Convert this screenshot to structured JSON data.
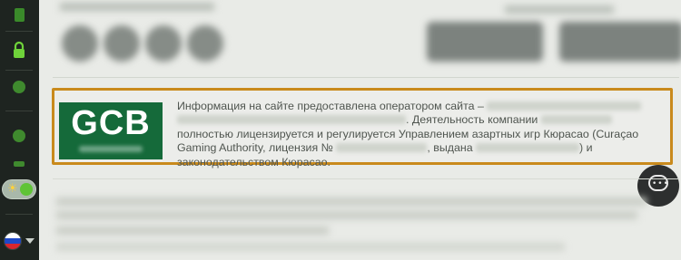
{
  "sidebar": {
    "icons": [
      {
        "name": "cards-icon",
        "color": "#3a8a2a"
      },
      {
        "name": "lock-icon",
        "color": "#6fd33a"
      },
      {
        "name": "bonus-icon",
        "color": "#3f8a2e"
      },
      {
        "name": "games-icon",
        "color": "#3f8a2e"
      },
      {
        "name": "trophy-icon",
        "color": "#3f8a2e"
      }
    ],
    "theme_toggle": {
      "sun_glyph": "☀",
      "state": "on"
    },
    "language_flag": "russia-flag"
  },
  "license_box": {
    "logo_text": "GCB",
    "text_1": "Информация на сайте предоставлена оператором сайта –",
    "text_2": ". Деятельность компании",
    "text_3": "полностью лицензируется и регулируется Управлением азартных игр Кюрасао (Curaçao Gaming Authority, лицензия №",
    "text_4": ", выдана",
    "text_5": ") и законодательством Кюрасао.",
    "border_color": "#c98a1c",
    "logo_bg": "#156a3a"
  },
  "chat": {
    "icon": "chat-icon"
  }
}
